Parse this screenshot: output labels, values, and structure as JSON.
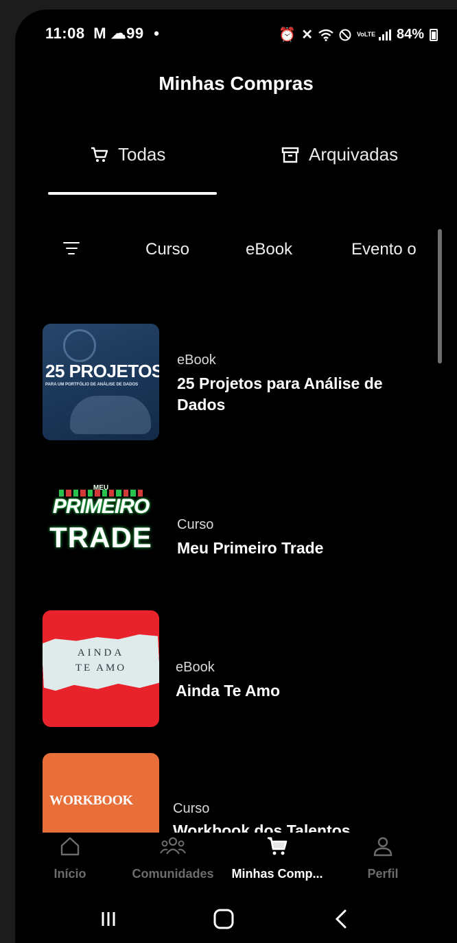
{
  "status_bar": {
    "time": "11:08",
    "notification_count": "99",
    "battery": "84%",
    "network": "VoLTE"
  },
  "header": {
    "title": "Minhas Compras"
  },
  "tabs": [
    {
      "label": "Todas",
      "active": true
    },
    {
      "label": "Arquivadas",
      "active": false
    }
  ],
  "filters": {
    "chips": [
      "Curso",
      "eBook",
      "Evento o"
    ]
  },
  "purchases": [
    {
      "category": "eBook",
      "name": "25 Projetos para Análise de Dados",
      "thumb_text": "25 PROJETOS",
      "thumb_subtext": "PARA UM PORTFÓLIO DE ANÁLISE DE DADOS"
    },
    {
      "category": "Curso",
      "name": "Meu Primeiro Trade",
      "thumb_text_top": "MEU",
      "thumb_text_mid": "PRIMEIRO",
      "thumb_text_bottom": "TRADE"
    },
    {
      "category": "eBook",
      "name": "Ainda Te Amo",
      "thumb_text_1": "AINDA",
      "thumb_text_2": "TE AMO"
    },
    {
      "category": "Curso",
      "name": "Workbook dos Talentos",
      "thumb_text": "WORKBOOK"
    }
  ],
  "bottom_nav": [
    {
      "label": "Início",
      "icon": "home-icon",
      "active": false
    },
    {
      "label": "Comunidades",
      "icon": "people-icon",
      "active": false
    },
    {
      "label": "Minhas Comp...",
      "icon": "cart-icon",
      "active": true
    },
    {
      "label": "Perfil",
      "icon": "person-icon",
      "active": false
    }
  ],
  "colors": {
    "background": "#000000",
    "text": "#ffffff",
    "inactive": "#6c6c6c"
  }
}
